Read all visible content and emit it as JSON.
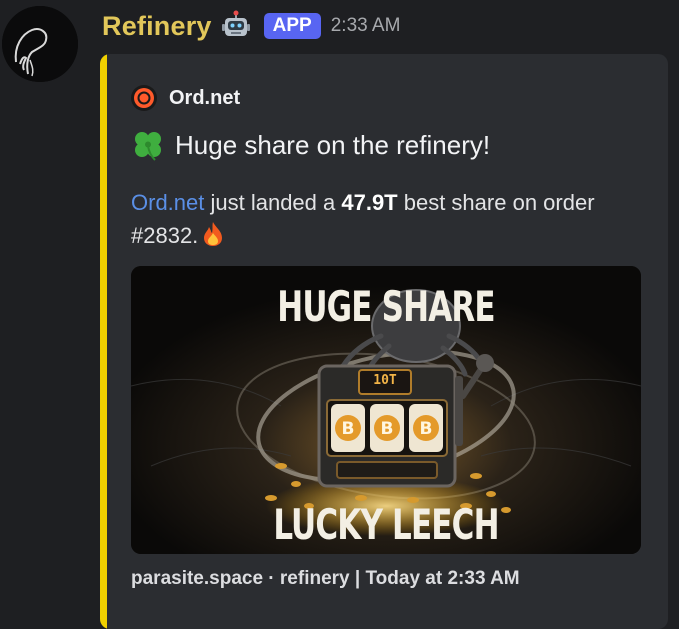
{
  "message": {
    "username": "Refinery",
    "bot_icon": "robot-icon",
    "badge": "APP",
    "timestamp": "2:33 AM"
  },
  "embed": {
    "accent_color": "#f0d000",
    "author": {
      "icon": "ord-logo-icon",
      "name": "Ord.net"
    },
    "title": {
      "emoji": "four-leaf-clover-icon",
      "text": "Huge share on the refinery!"
    },
    "description": {
      "link": "Ord.net",
      "text_1": " just landed a ",
      "bold": "47.9T",
      "text_2": " best share on order #2832.",
      "emoji": "fire-icon"
    },
    "image": {
      "top_text": "HUGE SHARE",
      "bottom_text": "LUCKY LEECH",
      "display_text": "10T"
    },
    "footer": "parasite.space · refinery | Today at 2:33 AM"
  }
}
